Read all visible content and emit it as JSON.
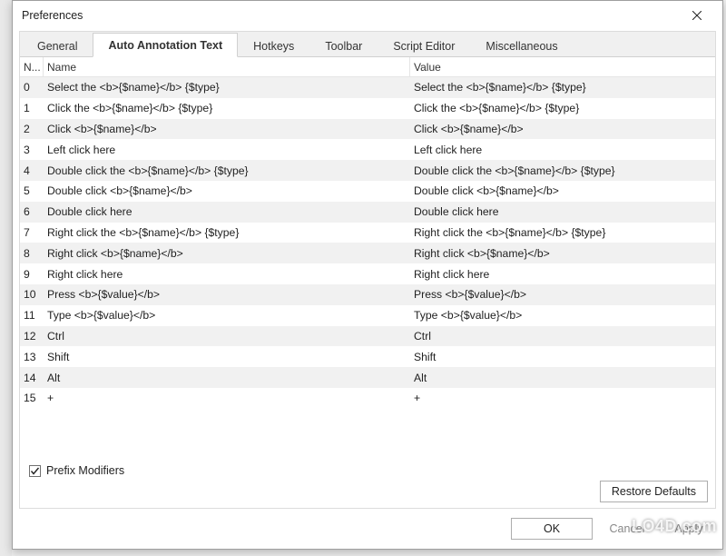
{
  "window": {
    "title": "Preferences"
  },
  "tabs": [
    {
      "label": "General"
    },
    {
      "label": "Auto Annotation Text"
    },
    {
      "label": "Hotkeys"
    },
    {
      "label": "Toolbar"
    },
    {
      "label": "Script Editor"
    },
    {
      "label": "Miscellaneous"
    }
  ],
  "active_tab": 1,
  "table": {
    "headers": {
      "nr": "N...",
      "name": "Name",
      "value": "Value"
    },
    "rows": [
      {
        "nr": "0",
        "name": "Select the  <b>{$name}</b>  {$type}",
        "value": "Select the  <b>{$name}</b>  {$type}"
      },
      {
        "nr": "1",
        "name": "Click the  <b>{$name}</b>  {$type}",
        "value": "Click the  <b>{$name}</b>  {$type}"
      },
      {
        "nr": "2",
        "name": "Click  <b>{$name}</b>",
        "value": "Click  <b>{$name}</b>"
      },
      {
        "nr": "3",
        "name": "Left click here",
        "value": "Left click here"
      },
      {
        "nr": "4",
        "name": "Double click the  <b>{$name}</b>  {$type}",
        "value": "Double click the  <b>{$name}</b>  {$type}"
      },
      {
        "nr": "5",
        "name": "Double click  <b>{$name}</b>",
        "value": "Double click  <b>{$name}</b>"
      },
      {
        "nr": "6",
        "name": "Double click here",
        "value": "Double click here"
      },
      {
        "nr": "7",
        "name": "Right click the  <b>{$name}</b>  {$type}",
        "value": "Right click the  <b>{$name}</b>  {$type}"
      },
      {
        "nr": "8",
        "name": "Right click  <b>{$name}</b>",
        "value": "Right click  <b>{$name}</b>"
      },
      {
        "nr": "9",
        "name": "Right click here",
        "value": "Right click here"
      },
      {
        "nr": "10",
        "name": "Press  <b>{$value}</b>",
        "value": "Press  <b>{$value}</b>"
      },
      {
        "nr": "11",
        "name": "Type  <b>{$value}</b>",
        "value": "Type  <b>{$value}</b>"
      },
      {
        "nr": "12",
        "name": "Ctrl",
        "value": "Ctrl"
      },
      {
        "nr": "13",
        "name": "Shift",
        "value": "Shift"
      },
      {
        "nr": "14",
        "name": "Alt",
        "value": "Alt"
      },
      {
        "nr": "15",
        "name": "+",
        "value": "+"
      }
    ]
  },
  "prefix_checkbox": {
    "label": "Prefix Modifiers",
    "checked": true
  },
  "buttons": {
    "restore": "Restore Defaults",
    "ok": "OK",
    "cancel": "Cancel",
    "apply": "Apply"
  },
  "watermark": "LO4D.com"
}
